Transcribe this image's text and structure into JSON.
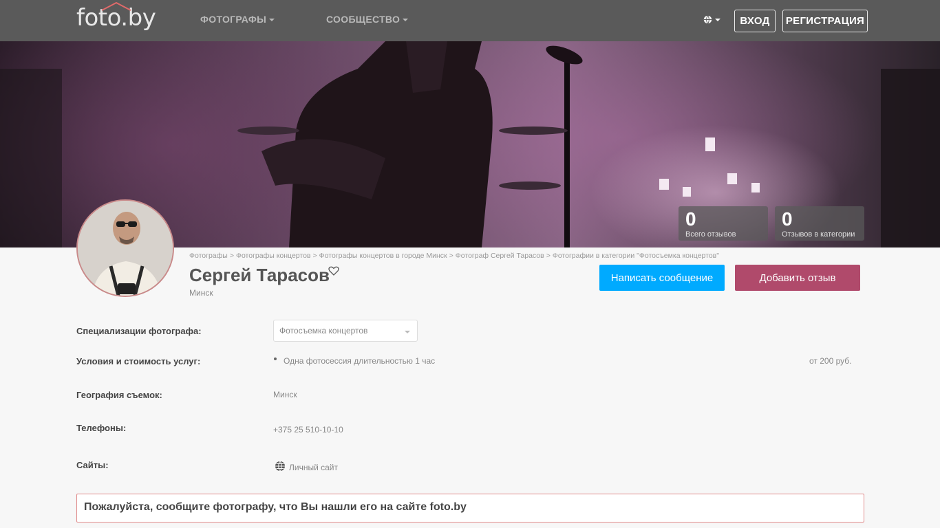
{
  "header": {
    "logo_text": "foto.by",
    "nav": [
      {
        "label": "ФОТОГРАФЫ"
      },
      {
        "label": "СООБЩЕСТВО"
      }
    ],
    "login_label": "ВХОД",
    "register_label": "РЕГИСТРАЦИЯ"
  },
  "stats": {
    "total_reviews": {
      "value": "0",
      "label": "Всего отзывов"
    },
    "category_reviews": {
      "value": "0",
      "label": "Отзывов в категории"
    }
  },
  "breadcrumb": [
    "Фотографы",
    "Фотографы концертов",
    "Фотографы концертов в городе Минск",
    "Фотограф Сергей Тарасов",
    "Фотографии в категории \"Фотосъемка концертов\""
  ],
  "profile": {
    "name": "Сергей Тарасов",
    "city": "Минск",
    "message_button": "Написать сообщение",
    "review_button": "Добавить отзыв"
  },
  "details": {
    "specializations_label": "Специализации фотографа:",
    "specialization_selected": "Фотосъемка концертов",
    "services_label": "Условия и стоимость услуг:",
    "service_name": "Одна фотосессия длительностью 1 час",
    "service_price": "от 200 руб.",
    "geography_label": "География съемок:",
    "geography_value": "Минск",
    "phones_label": "Телефоны:",
    "phone_value": "+375 25 510-10-10",
    "sites_label": "Сайты:",
    "site_value": "Личный сайт"
  },
  "notice": "Пожалуйста, сообщите фотографу, что Вы нашли его на сайте foto.by",
  "icons": [
    "globe-icon",
    "heart-icon",
    "caret-down-icon"
  ],
  "colors": {
    "primary": "#00aaff",
    "review": "#b04a6b",
    "topbar": "#5a5a5a"
  }
}
